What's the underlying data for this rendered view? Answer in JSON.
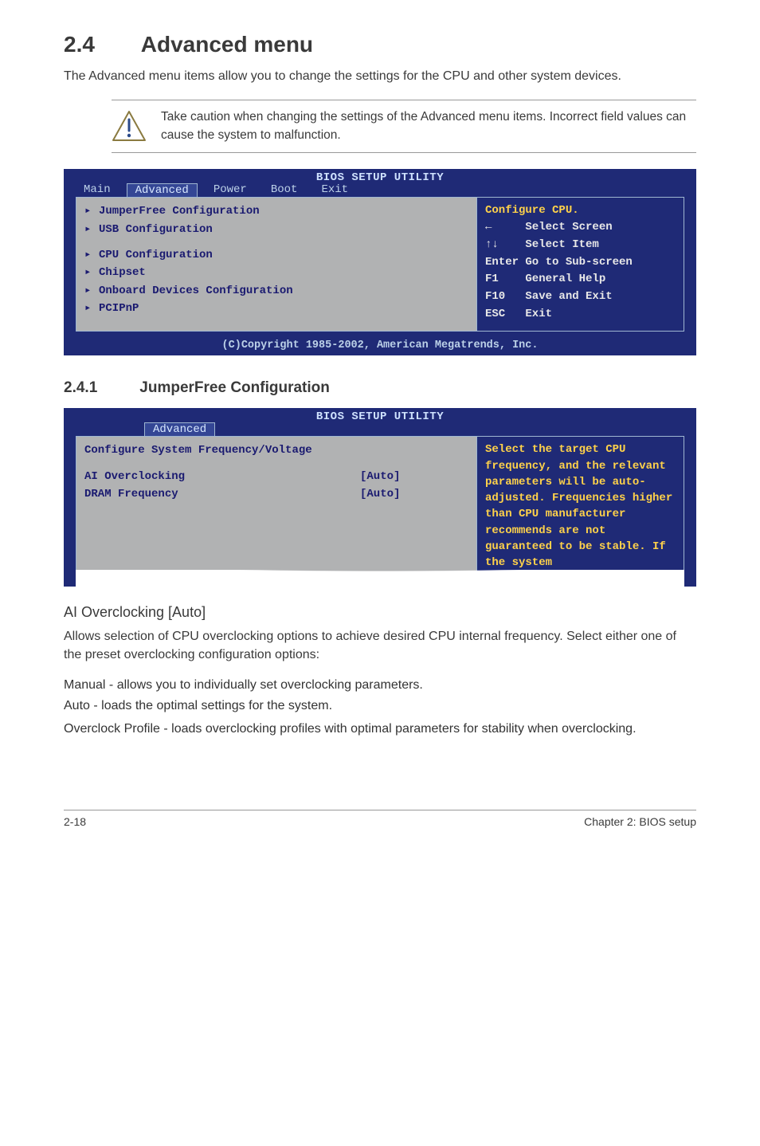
{
  "heading": {
    "number": "2.4",
    "title": "Advanced menu"
  },
  "intro": "The Advanced menu items allow you to change the settings for the CPU and other system devices.",
  "caution": "Take caution when changing the settings of the Advanced menu items. Incorrect field values can cause the system to malfunction.",
  "bios1": {
    "title": "BIOS SETUP UTILITY",
    "tabs": [
      "Main",
      "Advanced",
      "Power",
      "Boot",
      "Exit"
    ],
    "activeTab": "Advanced",
    "left": {
      "group1": [
        "JumperFree Configuration",
        "USB Configuration"
      ],
      "group2": [
        "CPU Configuration",
        "Chipset",
        "Onboard Devices Configuration",
        "PCIPnP"
      ]
    },
    "right": {
      "top": "Configure CPU.",
      "help": "←     Select Screen\n↑↓    Select Item\nEnter Go to Sub-screen\nF1    General Help\nF10   Save and Exit\nESC   Exit"
    },
    "footer": "(C)Copyright 1985-2002, American Megatrends, Inc."
  },
  "sub": {
    "number": "2.4.1",
    "title": "JumperFree Configuration"
  },
  "bios2": {
    "title": "BIOS SETUP UTILITY",
    "activeTab": "Advanced",
    "leftTitle": "Configure System Frequency/Voltage",
    "rows": [
      {
        "label": "AI Overclocking",
        "value": "[Auto]"
      },
      {
        "label": "DRAM Frequency",
        "value": "[Auto]"
      }
    ],
    "right": "Select the target CPU frequency, and the relevant parameters will be auto-adjusted. Frequencies higher than CPU manufacturer recommends are not guaranteed to be stable. If the system"
  },
  "aioc": {
    "heading": "AI Overclocking [Auto]",
    "body": "Allows selection of CPU overclocking options to achieve desired CPU internal frequency. Select either one of the preset overclocking configuration options:",
    "items": [
      "Manual - allows you to individually set overclocking parameters.",
      "Auto - loads the optimal settings for the system.",
      "Overclock Profile - loads overclocking profiles with optimal parameters for stability when overclocking."
    ]
  },
  "footer": {
    "left": "2-18",
    "right": "Chapter 2: BIOS setup"
  }
}
